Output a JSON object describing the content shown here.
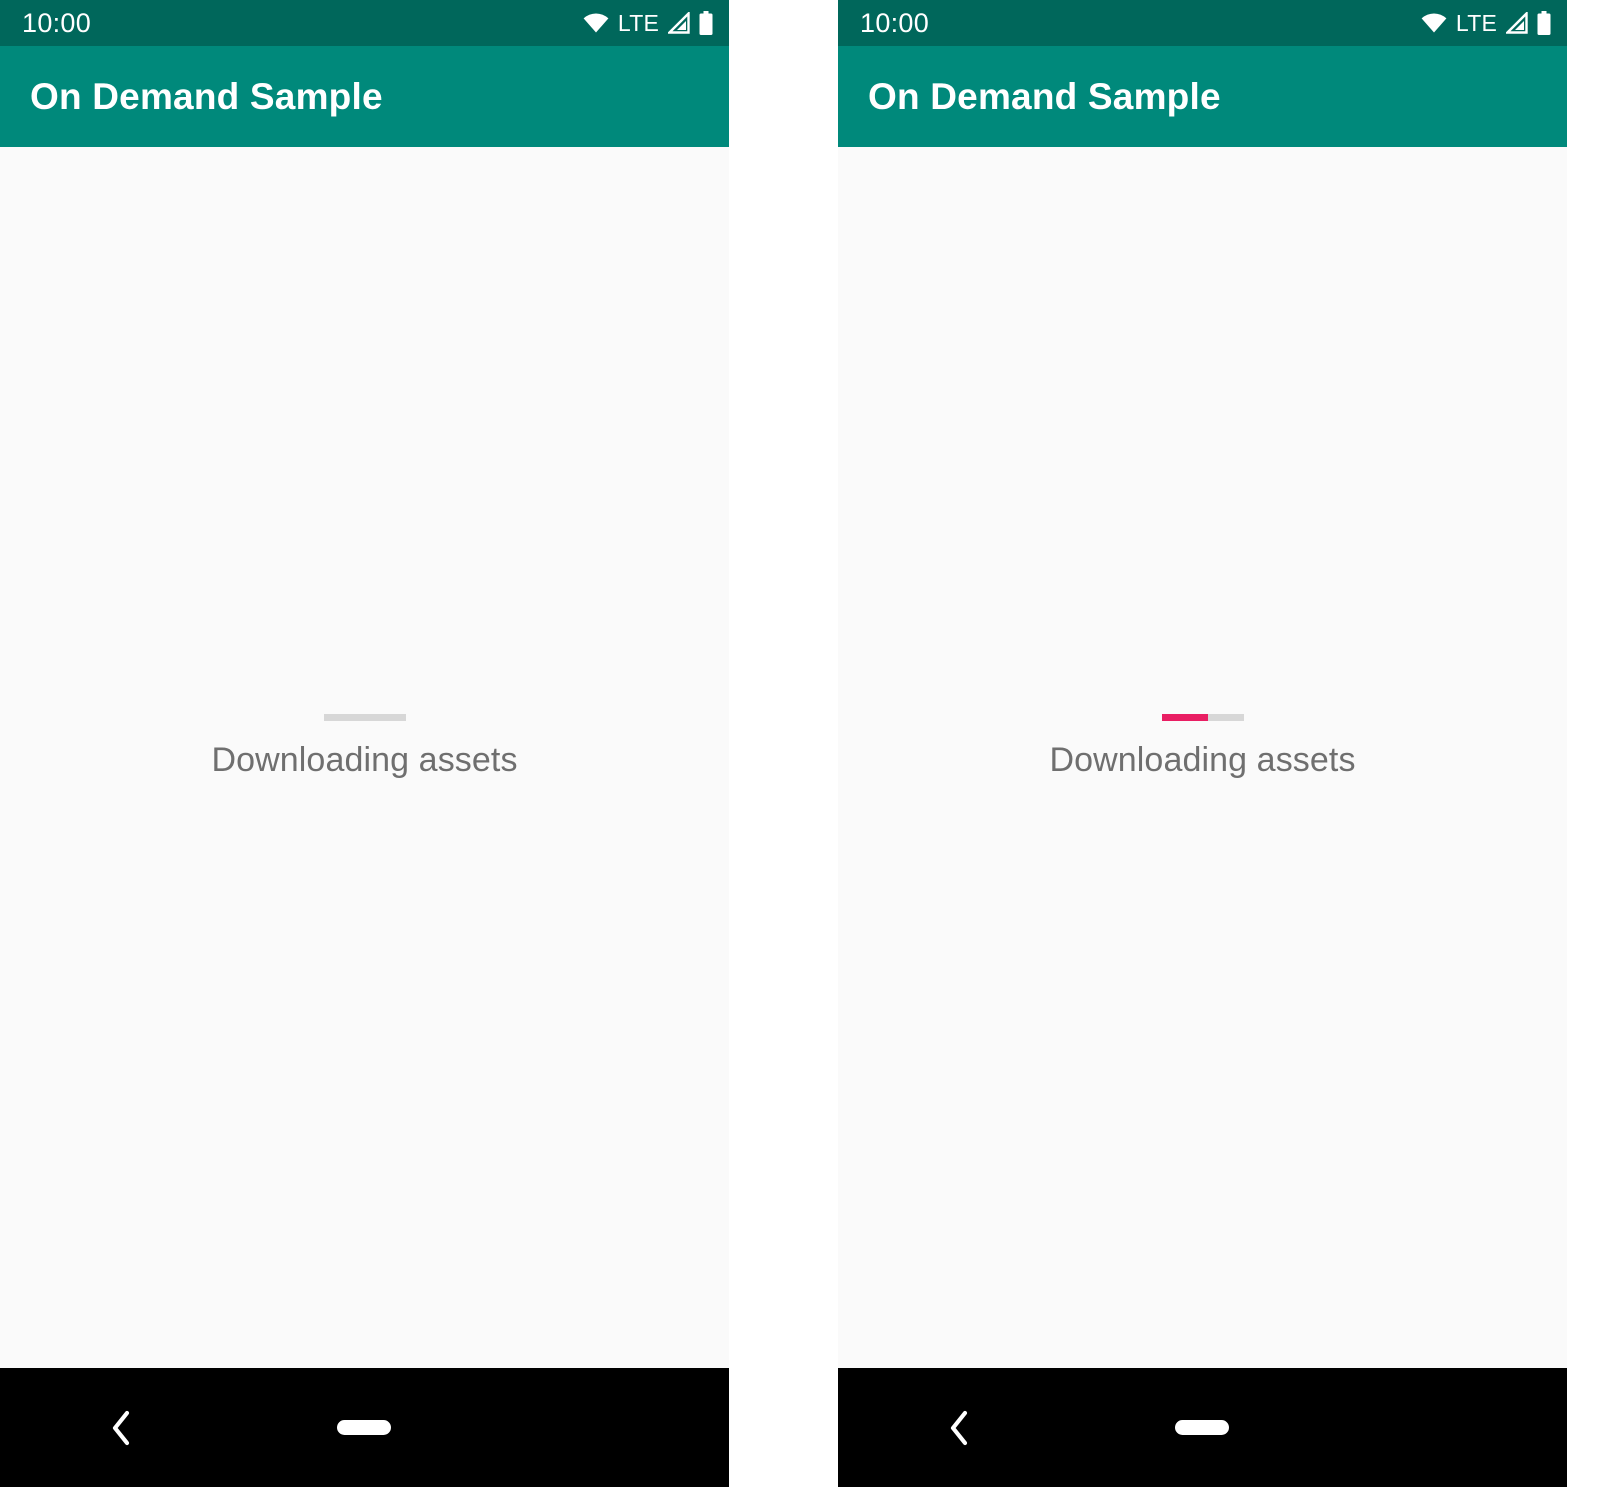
{
  "meta": {
    "panels": 2,
    "caption": "Two Android phone screenshots side by side of the On Demand Sample app showing asset download progress"
  },
  "colors": {
    "status_bar": "#00675b",
    "app_bar": "#00897b",
    "content_background": "#fafafa",
    "progress_track": "#d7d7d7",
    "progress_accent": "#e91e63",
    "label_text": "#6f6f6f",
    "nav_bar": "#000000",
    "on_primary_text": "#ffffff"
  },
  "status_bar": {
    "clock": "10:00",
    "network_label": "LTE",
    "icons": [
      "wifi-icon",
      "lte-label",
      "cellular-signal-icon",
      "battery-icon"
    ]
  },
  "app_bar": {
    "title": "On Demand Sample"
  },
  "navigation_bar": {
    "back_label": "Back",
    "home_label": "Home",
    "icons": [
      "back-chevron-icon",
      "home-pill-icon"
    ]
  },
  "panels": [
    {
      "id": "panel-left",
      "state_label": "download-not-started",
      "status_bar": {
        "clock": "10:00",
        "network_label": "LTE"
      },
      "app_bar": {
        "title": "On Demand Sample"
      },
      "loading": {
        "label": "Downloading assets",
        "progress_percent": 0,
        "progress_visible": false
      }
    },
    {
      "id": "panel-right",
      "state_label": "download-in-progress",
      "status_bar": {
        "clock": "10:00",
        "network_label": "LTE"
      },
      "app_bar": {
        "title": "On Demand Sample"
      },
      "loading": {
        "label": "Downloading assets",
        "progress_percent": 57,
        "progress_visible": true
      }
    }
  ]
}
